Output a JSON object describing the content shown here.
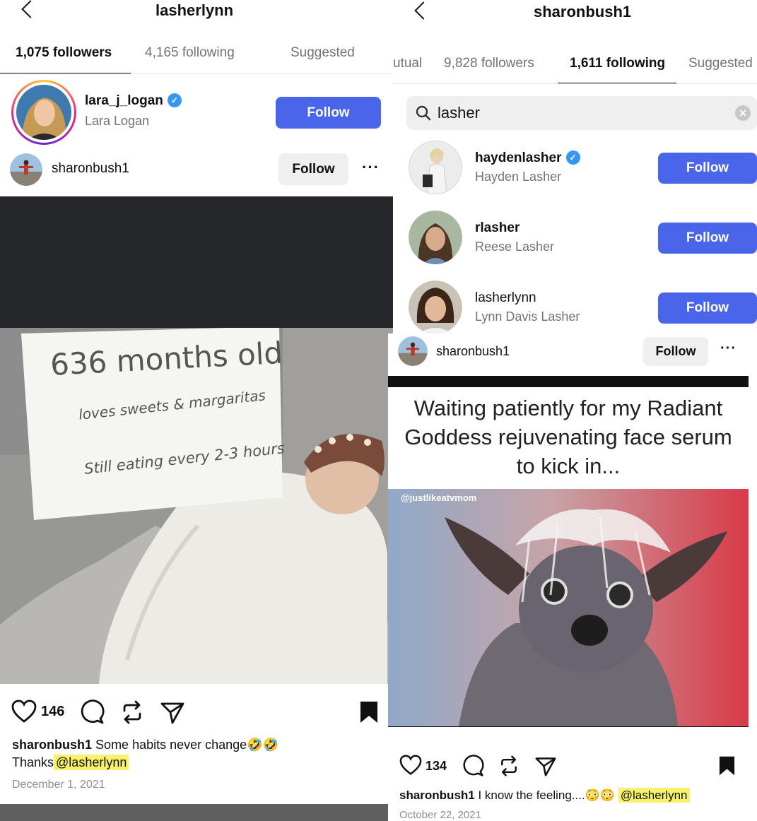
{
  "left": {
    "title": "lasherlynn",
    "tabs": [
      {
        "label": "1,075 followers"
      },
      {
        "label": "4,165 following"
      },
      {
        "label": "Suggested"
      }
    ],
    "suggested_user": {
      "username": "lara_j_logan",
      "name": "Lara Logan",
      "button": "Follow"
    },
    "post": {
      "author": "sharonbush1",
      "follow": "Follow",
      "sign_line1": "636 months old",
      "sign_line2": "loves sweets & margaritas",
      "sign_line3": "Still eating every 2-3 hours",
      "likes": "146",
      "caption_user": "sharonbush1",
      "caption_text": "Some habits never change🤣🤣",
      "caption_line2": "Thanks",
      "mention": "@lasherlynn",
      "date": "December 1, 2021"
    }
  },
  "right_top": {
    "title": "sharonbush1",
    "tabs": [
      {
        "label": "utual"
      },
      {
        "label": "9,828 followers"
      },
      {
        "label": "1,611 following"
      },
      {
        "label": "Suggested"
      }
    ],
    "search": {
      "value": "lasher"
    },
    "results": [
      {
        "username": "haydenlasher",
        "name": "Hayden Lasher",
        "verified": true,
        "button": "Follow"
      },
      {
        "username": "rlasher",
        "name": "Reese Lasher",
        "verified": false,
        "button": "Follow"
      },
      {
        "username": "lasherlynn",
        "name": "Lynn Davis Lasher",
        "verified": false,
        "button": "Follow"
      }
    ]
  },
  "right_bottom": {
    "author": "sharonbush1",
    "follow": "Follow",
    "meme_line1": "Waiting patiently for my Radiant",
    "meme_line2": "Goddess rejuvenating face serum",
    "meme_line3": "to kick in...",
    "watermark": "@justlikeatvmom",
    "likes": "134",
    "caption_user": "sharonbush1",
    "caption_text": "I know the feeling....😳😳",
    "mention": "@lasherlynn",
    "date": "October 22, 2021"
  },
  "colors": {
    "follow_blue": "#4a65e9",
    "highlight": "#f7f26a",
    "verified": "#3897f0"
  }
}
